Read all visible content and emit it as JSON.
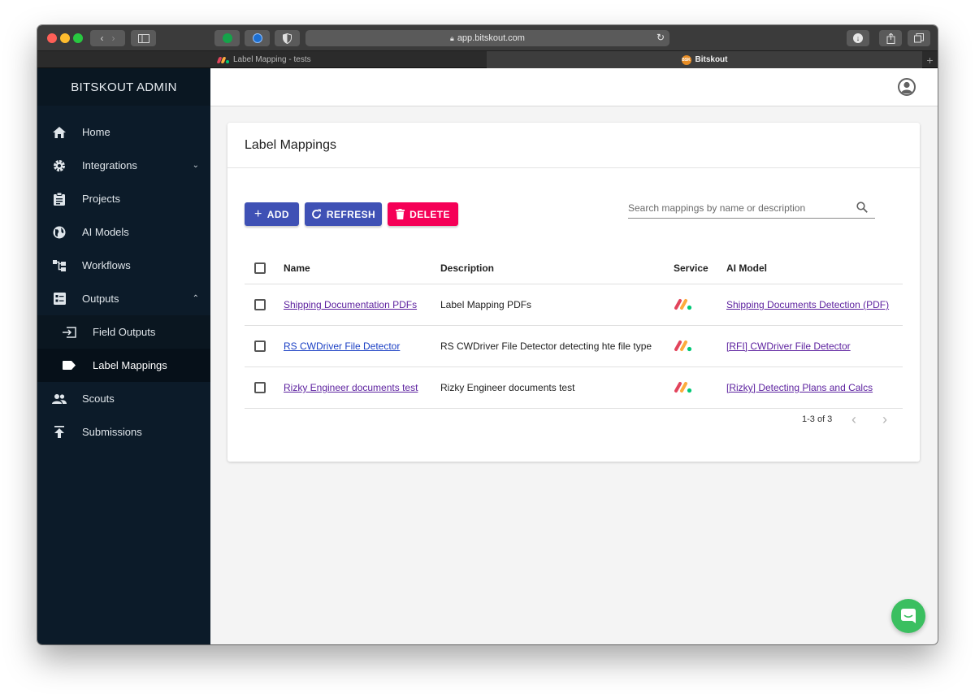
{
  "browser": {
    "url": "app.bitskout.com",
    "tabs": [
      {
        "label": "Label Mapping - tests",
        "active": false
      },
      {
        "label": "Bitskout",
        "active": true
      }
    ],
    "favicon_text": "BSK"
  },
  "sidebar": {
    "brand": "BITSKOUT ADMIN",
    "items": [
      {
        "label": "Home",
        "icon": "home-icon"
      },
      {
        "label": "Integrations",
        "icon": "gear-icon",
        "expandable": "collapsed"
      },
      {
        "label": "Projects",
        "icon": "clipboard-icon"
      },
      {
        "label": "AI Models",
        "icon": "globe-icon"
      },
      {
        "label": "Workflows",
        "icon": "workflow-icon"
      },
      {
        "label": "Outputs",
        "icon": "outputs-icon",
        "expandable": "expanded"
      },
      {
        "label": "Field Outputs",
        "icon": "field-outputs-icon",
        "sub": true
      },
      {
        "label": "Label Mappings",
        "icon": "label-icon",
        "sub": true,
        "selected": true
      },
      {
        "label": "Scouts",
        "icon": "people-icon"
      },
      {
        "label": "Submissions",
        "icon": "upload-icon"
      }
    ]
  },
  "page": {
    "title": "Label Mappings",
    "buttons": {
      "add": "ADD",
      "refresh": "REFRESH",
      "delete": "DELETE"
    },
    "search": {
      "placeholder": "Search mappings by name or description",
      "value": ""
    },
    "columns": [
      "Name",
      "Description",
      "Service",
      "AI Model"
    ],
    "rows": [
      {
        "name": "Shipping Documentation PDFs",
        "description": "Label Mapping PDFs",
        "service": "monday-logo",
        "ai_model": "Shipping Documents Detection (PDF)"
      },
      {
        "name": "RS CWDriver File Detector",
        "description": "RS CWDriver File Detector detecting hte file type",
        "service": "monday-logo",
        "ai_model": "[RFI] CWDriver File Detector"
      },
      {
        "name": "Rizky Engineer documents test",
        "description": "Rizky Engineer documents test",
        "service": "monday-logo",
        "ai_model": "[Rizky] Detecting Plans and Calcs"
      }
    ],
    "pagination": "1-3 of 3"
  },
  "colors": {
    "sidebar_bg": "#0c1b29",
    "primary": "#3f51b5",
    "danger": "#f50057",
    "chat_fab": "#3bbf60"
  }
}
